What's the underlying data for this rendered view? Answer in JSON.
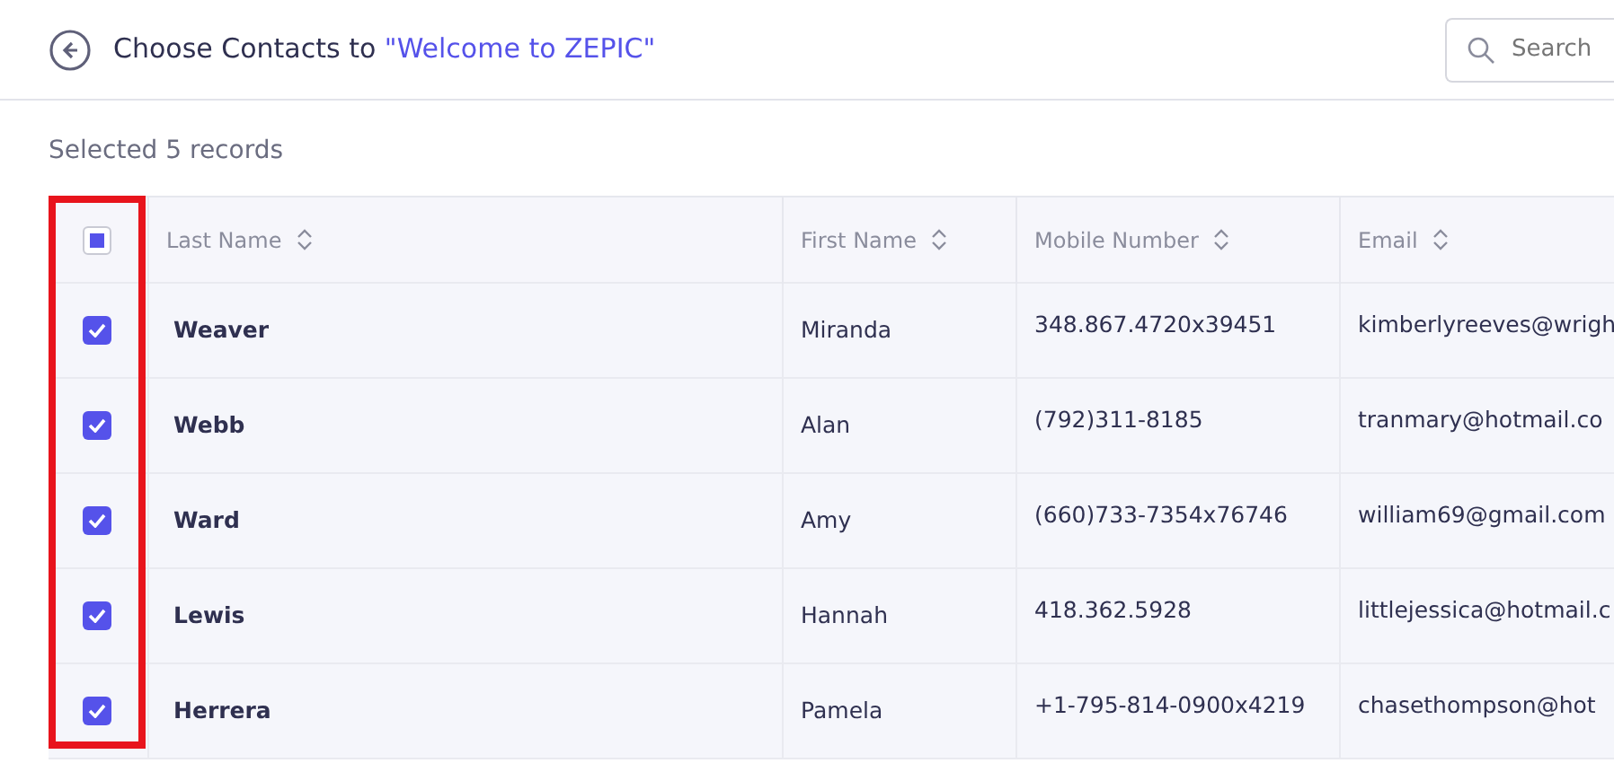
{
  "header": {
    "title": "Choose Contacts to ",
    "campaign": "\"Welcome to ZEPIC\"",
    "search": {
      "placeholder": "Search"
    }
  },
  "selection_summary": "Selected 5 records",
  "table": {
    "select_all": {
      "indeterminate": true
    },
    "columns": [
      "Last Name",
      "First Name",
      "Mobile Number",
      "Email"
    ],
    "rows": [
      {
        "checked": true,
        "cells": [
          "Weaver",
          "Miranda",
          "348.867.4720x39451",
          "kimberlyreeves@wrigh"
        ]
      },
      {
        "checked": true,
        "cells": [
          "Webb",
          "Alan",
          "(792)311-8185",
          "tranmary@hotmail.co"
        ]
      },
      {
        "checked": true,
        "cells": [
          "Ward",
          "Amy",
          "(660)733-7354x76746",
          "william69@gmail.com"
        ]
      },
      {
        "checked": true,
        "cells": [
          "Lewis",
          "Hannah",
          "418.362.5928",
          "littlejessica@hotmail.c"
        ]
      },
      {
        "checked": true,
        "cells": [
          "Herrera",
          "Pamela",
          "+1-795-814-0900x4219",
          "chasethompson@hot"
        ]
      }
    ]
  },
  "annotation": {
    "kind": "highlight",
    "color": "#e8141c"
  }
}
